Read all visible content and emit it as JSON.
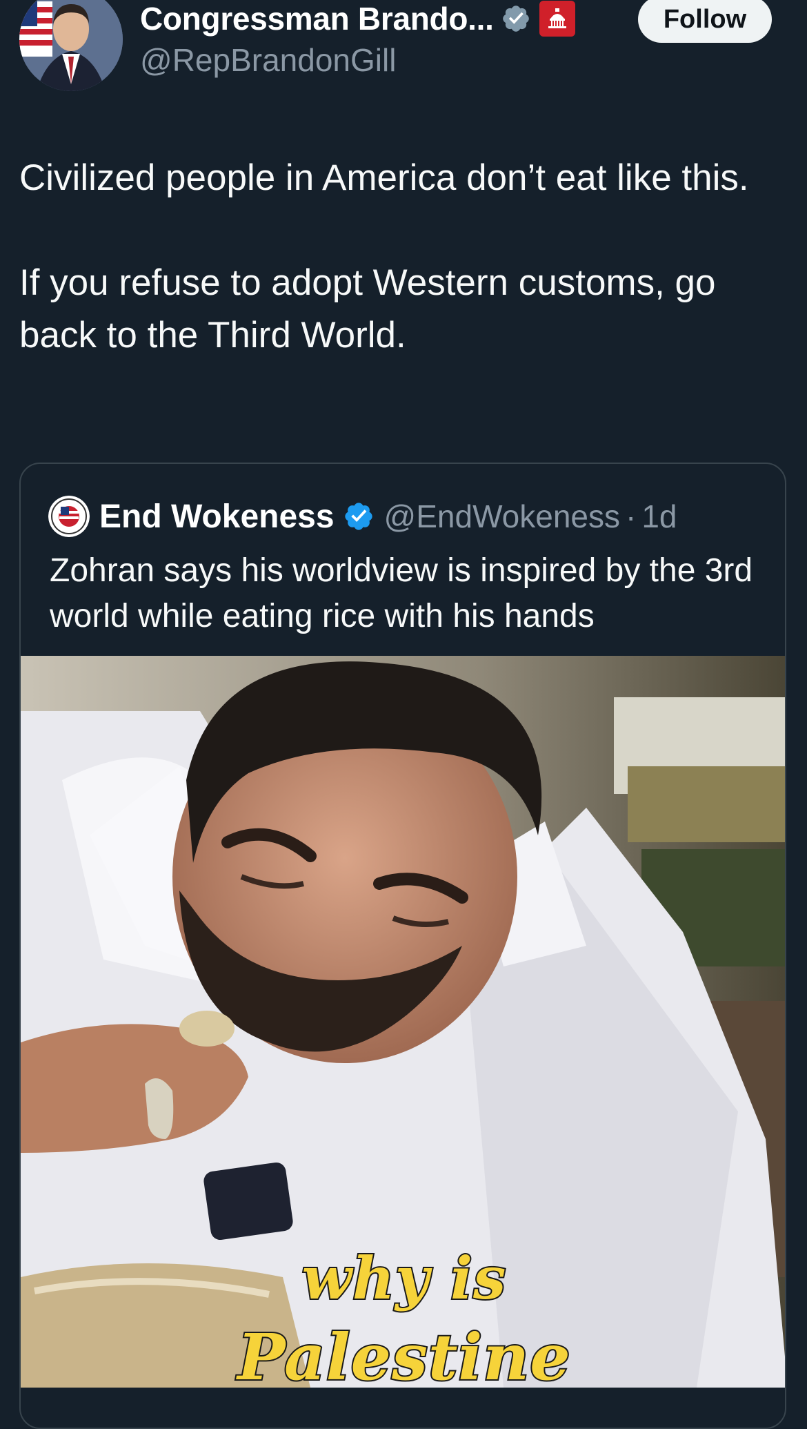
{
  "author": {
    "display_name": "Congressman Brando...",
    "handle": "@RepBrandonGill",
    "avatar_icon": "profile-photo",
    "verified_icon": "verified-gray-badge-icon",
    "affiliation_icon": "capitol-dome-icon"
  },
  "follow_button": {
    "label": "Follow"
  },
  "tweet": {
    "paragraph_1": "Civilized people in America don’t eat like this.",
    "paragraph_2": "If you refuse to adopt Western customs, go back to the Third World."
  },
  "quoted_tweet": {
    "display_name": "End Wokeness",
    "handle": "@EndWokeness",
    "separator": "·",
    "time": "1d",
    "text": "Zohran says his worldview is inspired by the 3rd world while eating rice with his hands",
    "verified_icon": "verified-blue-badge-icon",
    "media": {
      "caption_line_1": "why is",
      "caption_line_2": "Palestine"
    }
  },
  "colors": {
    "background": "#15202b",
    "text_primary": "#f7f9f9",
    "text_secondary": "#8b98a5",
    "verified_blue": "#1d9bf0",
    "follow_button_bg": "#eff3f4",
    "caption_yellow": "#f6d33a"
  }
}
